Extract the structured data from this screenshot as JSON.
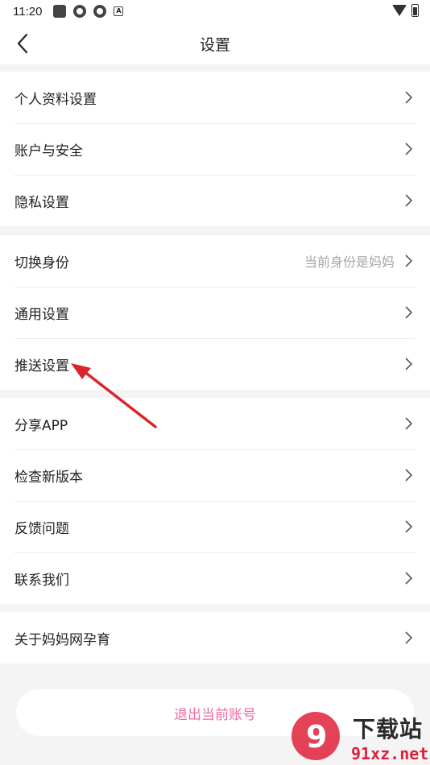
{
  "status_bar": {
    "time": "11:20",
    "a_icon_label": "A"
  },
  "header": {
    "title": "设置"
  },
  "groups": [
    {
      "items": [
        {
          "label": "个人资料设置"
        },
        {
          "label": "账户与安全"
        },
        {
          "label": "隐私设置"
        }
      ]
    },
    {
      "items": [
        {
          "label": "切换身份",
          "sub": "当前身份是妈妈"
        },
        {
          "label": "通用设置"
        },
        {
          "label": "推送设置"
        }
      ]
    },
    {
      "items": [
        {
          "label": "分享APP"
        },
        {
          "label": "检查新版本"
        },
        {
          "label": "反馈问题"
        },
        {
          "label": "联系我们"
        }
      ]
    },
    {
      "items": [
        {
          "label": "关于妈妈网孕育"
        }
      ]
    }
  ],
  "logout": {
    "label": "退出当前账号"
  },
  "watermark": {
    "text": "下载站",
    "url": "91xz.net",
    "logo_mark": "9"
  },
  "colors": {
    "accent_pink": "#f06aa6",
    "arrow_red": "#d9252b",
    "background": "#f4f4f4"
  }
}
